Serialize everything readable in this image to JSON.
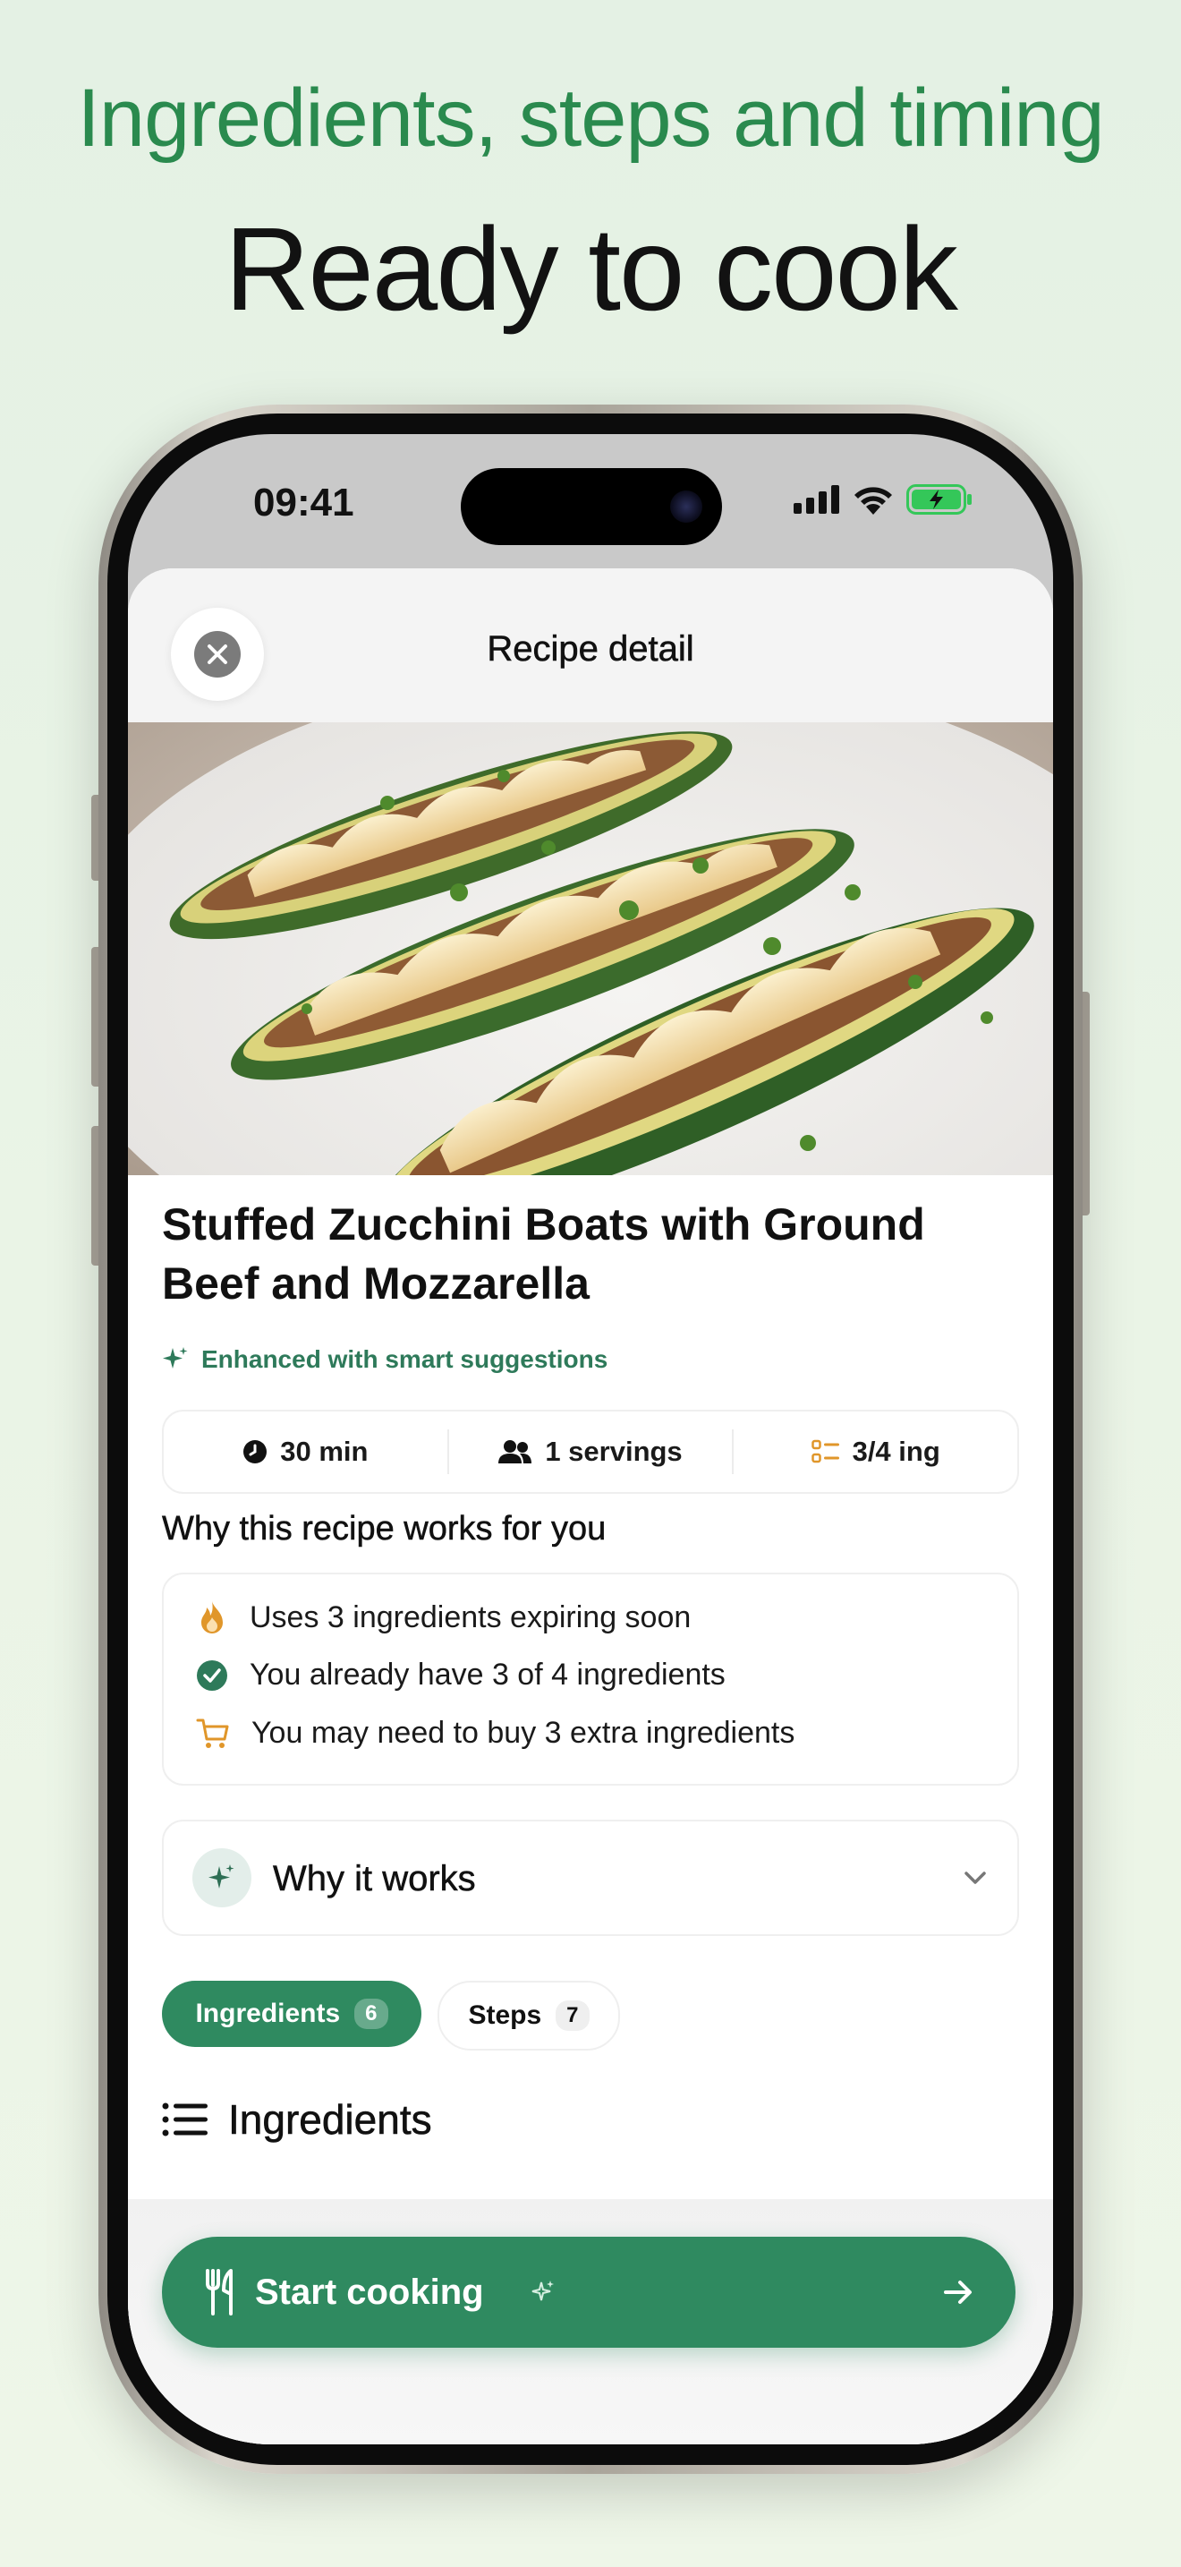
{
  "promo": {
    "headline": "Ingredients, steps and timing",
    "title": "Ready to cook"
  },
  "status_bar": {
    "time": "09:41"
  },
  "header": {
    "title": "Recipe detail"
  },
  "recipe": {
    "title": "Stuffed Zucchini Boats with Ground Beef and Mozzarella",
    "enhanced_label": "Enhanced with smart suggestions"
  },
  "stats": {
    "time": "30 min",
    "servings": "1 servings",
    "ingredients": "3/4 ing"
  },
  "why_section": {
    "title": "Why this recipe works for you",
    "items": [
      {
        "icon": "flame-icon",
        "text": "Uses 3 ingredients expiring soon"
      },
      {
        "icon": "check-circle-icon",
        "text": "You already have 3 of 4 ingredients"
      },
      {
        "icon": "cart-icon",
        "text": "You may need to buy 3 extra ingredients"
      }
    ]
  },
  "why_it_works": {
    "label": "Why it works"
  },
  "tabs": [
    {
      "label": "Ingredients",
      "count": "6",
      "active": true
    },
    {
      "label": "Steps",
      "count": "7",
      "active": false
    }
  ],
  "ingredients_heading": "Ingredients",
  "cta": {
    "label": "Start cooking"
  },
  "colors": {
    "accent": "#2f8a60",
    "headline": "#2a8a4e",
    "flame": "#e0962a",
    "cart": "#e0962a"
  }
}
